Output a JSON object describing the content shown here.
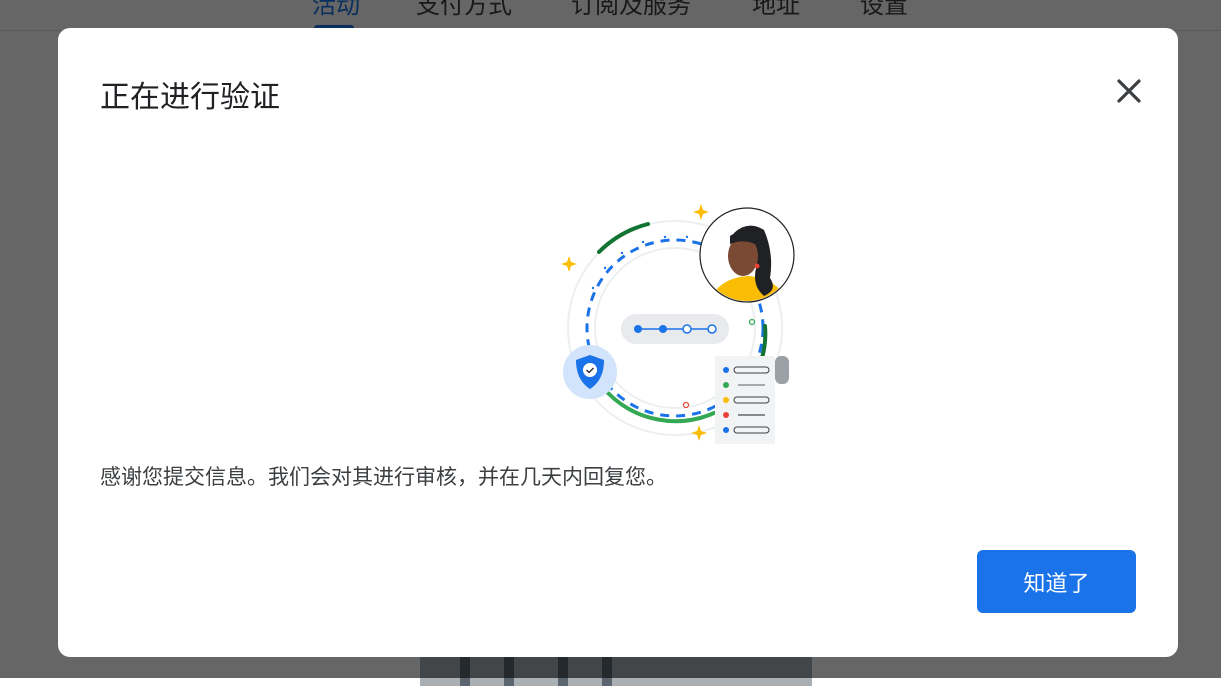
{
  "background": {
    "tabs": [
      {
        "label": "活动",
        "active": true
      },
      {
        "label": "支付方式",
        "active": false
      },
      {
        "label": "订阅及服务",
        "active": false
      },
      {
        "label": "地址",
        "active": false
      },
      {
        "label": "设置",
        "active": false
      }
    ]
  },
  "dialog": {
    "title": "正在进行验证",
    "close_icon": "close-icon",
    "message": "感谢您提交信息。我们会对其进行审核，并在几天内回复您。",
    "ok_label": "知道了"
  },
  "colors": {
    "accent": "#1a73e8",
    "green": "#34a853",
    "dark_green": "#137333",
    "yellow": "#fbbc04",
    "red": "#ea4335"
  }
}
